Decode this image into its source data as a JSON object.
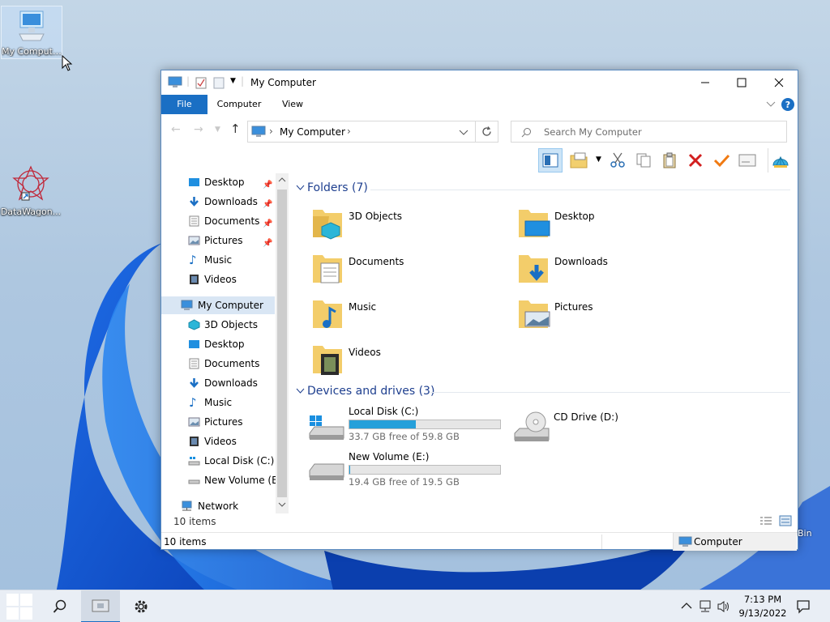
{
  "desktop": {
    "icons": [
      {
        "label": "My Computer",
        "icon": "computer-icon"
      },
      {
        "label": "DataWagon...",
        "icon": "datawagon-logo-icon"
      }
    ],
    "recycle_bin_partial": "Bin"
  },
  "window": {
    "title": "My Computer",
    "ribbon_tabs": [
      "File",
      "Computer",
      "View"
    ],
    "address": {
      "path": "My Computer"
    },
    "search": {
      "placeholder": "Search My Computer"
    },
    "toolbar_icons": [
      "preview-pane-icon",
      "properties-icon",
      "cut-icon",
      "copy-icon",
      "paste-icon",
      "delete-icon",
      "rename-check-icon",
      "mail-icon",
      "shell-icon"
    ],
    "nav_pane": {
      "quick_access": [
        {
          "label": "Desktop",
          "pinned": true
        },
        {
          "label": "Downloads",
          "pinned": true
        },
        {
          "label": "Documents",
          "pinned": true
        },
        {
          "label": "Pictures",
          "pinned": true
        },
        {
          "label": "Music",
          "pinned": false
        },
        {
          "label": "Videos",
          "pinned": false
        }
      ],
      "this_pc": "My Computer",
      "this_pc_items": [
        "3D Objects",
        "Desktop",
        "Documents",
        "Downloads",
        "Music",
        "Pictures",
        "Videos",
        "Local Disk (C:)",
        "New Volume (E:)"
      ],
      "network": "Network",
      "count": "10 items"
    },
    "folders_group": "Folders (7)",
    "folders": [
      "3D Objects",
      "Desktop",
      "Documents",
      "Downloads",
      "Music",
      "Pictures",
      "Videos"
    ],
    "drives_group": "Devices and drives (3)",
    "drives": [
      {
        "name": "Local Disk (C:)",
        "free": "33.7 GB free of 59.8 GB",
        "used_fraction": 0.44
      },
      {
        "name": "CD Drive (D:)"
      },
      {
        "name": "New Volume (E:)",
        "free": "19.4 GB free of 19.5 GB",
        "used_fraction": 0.005
      }
    ],
    "status": {
      "left": "10 items",
      "right": "Computer"
    }
  },
  "taskbar": {
    "time": "7:13 PM",
    "date": "9/13/2022"
  },
  "colors": {
    "accent": "#1a6fc4",
    "drive_fill": "#26a0da"
  }
}
